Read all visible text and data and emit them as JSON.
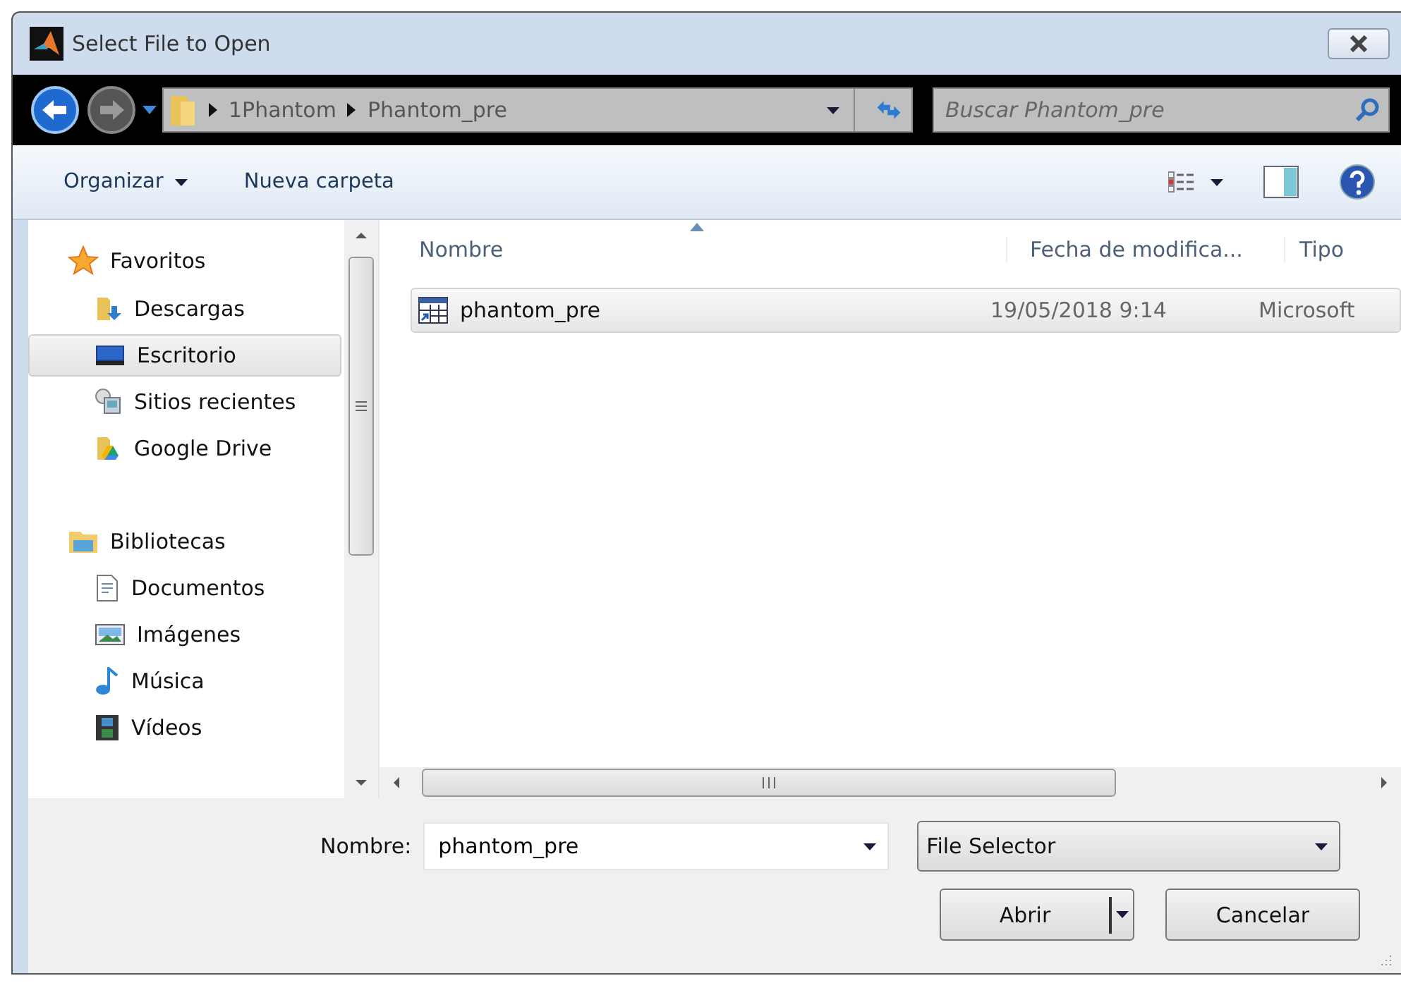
{
  "window": {
    "title": "Select File to Open"
  },
  "address_bar": {
    "path": [
      "1Phantom",
      "Phantom_pre"
    ]
  },
  "search": {
    "placeholder": "Buscar Phantom_pre"
  },
  "toolbar": {
    "organize": "Organizar",
    "new_folder": "Nueva carpeta"
  },
  "sidebar": {
    "groups": [
      {
        "label": "Favoritos",
        "children": [
          {
            "label": "Descargas",
            "selected": false
          },
          {
            "label": "Escritorio",
            "selected": true
          },
          {
            "label": "Sitios recientes",
            "selected": false
          },
          {
            "label": "Google Drive",
            "selected": false
          }
        ]
      },
      {
        "label": "Bibliotecas",
        "children": [
          {
            "label": "Documentos",
            "selected": false
          },
          {
            "label": "Imágenes",
            "selected": false
          },
          {
            "label": "Música",
            "selected": false
          },
          {
            "label": "Vídeos",
            "selected": false
          }
        ]
      }
    ]
  },
  "table": {
    "columns": [
      "Nombre",
      "Fecha de modifica...",
      "Tipo"
    ],
    "rows": [
      {
        "cells": [
          "phantom_pre",
          "19/05/2018 9:14",
          "Microsoft"
        ],
        "selected": true
      }
    ]
  },
  "footer": {
    "name_label": "Nombre:",
    "name_value": "phantom_pre",
    "filter": "File Selector",
    "open": "Abrir",
    "cancel": "Cancelar"
  }
}
